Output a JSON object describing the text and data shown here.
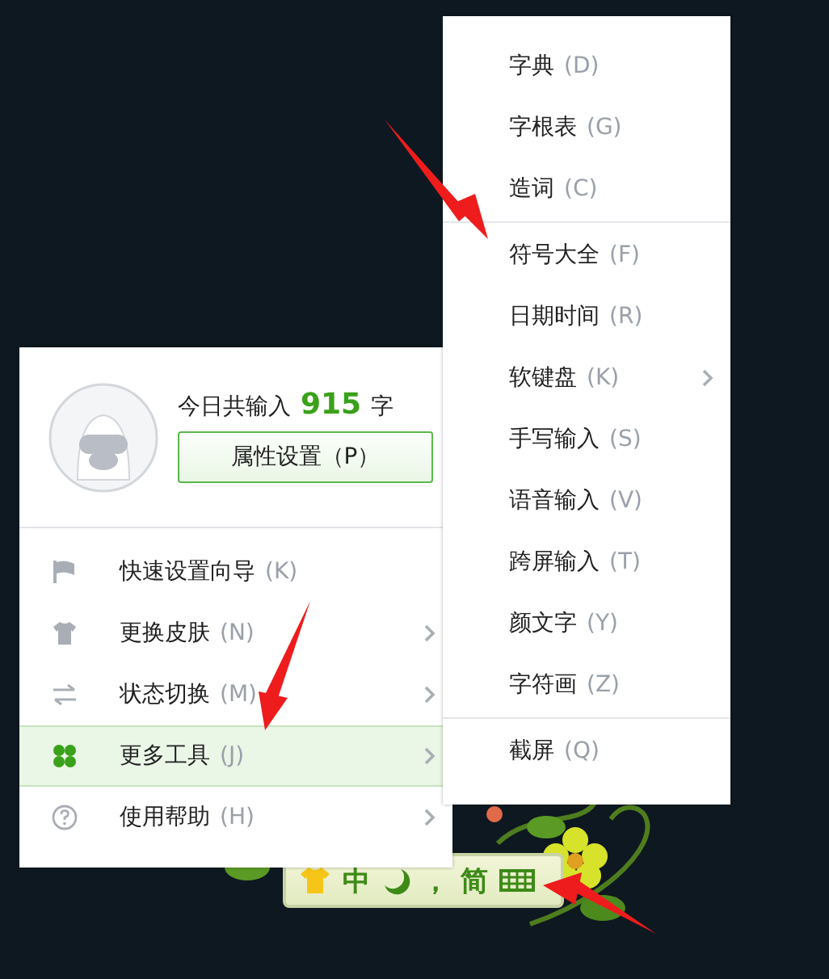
{
  "main_menu": {
    "today_label": "今日共输入",
    "count": "915",
    "unit": "字",
    "settings_button": "属性设置（P）",
    "items": [
      {
        "label": "快速设置向导",
        "key": "(K)",
        "has_submenu": false,
        "selected": false
      },
      {
        "label": "更换皮肤",
        "key": "(N)",
        "has_submenu": true,
        "selected": false
      },
      {
        "label": "状态切换",
        "key": "(M)",
        "has_submenu": true,
        "selected": false
      },
      {
        "label": "更多工具",
        "key": "(J)",
        "has_submenu": true,
        "selected": true
      },
      {
        "label": "使用帮助",
        "key": "(H)",
        "has_submenu": true,
        "selected": false
      }
    ]
  },
  "submenu": {
    "groups": [
      [
        {
          "label": "字典",
          "key": "(D)",
          "has_submenu": false
        },
        {
          "label": "字根表",
          "key": "(G)",
          "has_submenu": false
        },
        {
          "label": "造词",
          "key": "(C)",
          "has_submenu": false
        }
      ],
      [
        {
          "label": "符号大全",
          "key": "(F)",
          "has_submenu": false
        },
        {
          "label": "日期时间",
          "key": "(R)",
          "has_submenu": false
        },
        {
          "label": "软键盘",
          "key": "(K)",
          "has_submenu": true
        },
        {
          "label": "手写输入",
          "key": "(S)",
          "has_submenu": false
        },
        {
          "label": "语音输入",
          "key": "(V)",
          "has_submenu": false
        },
        {
          "label": "跨屏输入",
          "key": "(T)",
          "has_submenu": false
        },
        {
          "label": "颜文字",
          "key": "(Y)",
          "has_submenu": false
        },
        {
          "label": "字符画",
          "key": "(Z)",
          "has_submenu": false
        }
      ],
      [
        {
          "label": "截屏",
          "key": "(Q)",
          "has_submenu": false
        }
      ]
    ]
  },
  "status_bar": {
    "items": [
      {
        "kind": "shirt"
      },
      {
        "kind": "text",
        "text": "中"
      },
      {
        "kind": "moon"
      },
      {
        "kind": "text",
        "text": "，"
      },
      {
        "kind": "text",
        "text": "简"
      },
      {
        "kind": "keyboard"
      }
    ]
  }
}
